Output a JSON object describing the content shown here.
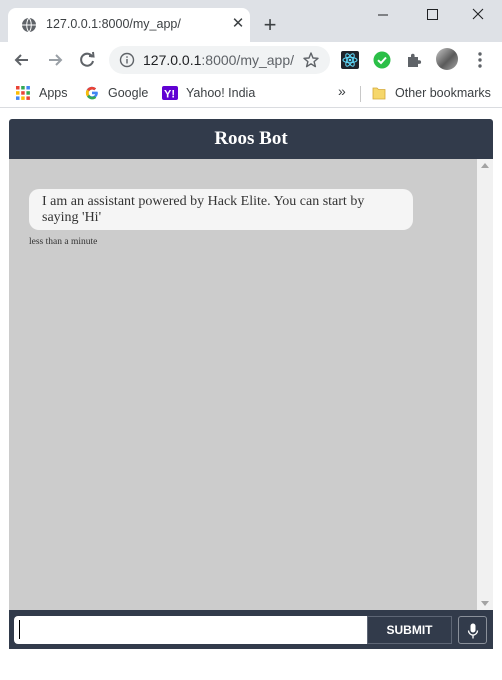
{
  "browser": {
    "tab": {
      "title": "127.0.0.1:8000/my_app/",
      "close_glyph": "✕"
    },
    "new_tab_glyph": "+",
    "address": {
      "host": "127.0.0.1",
      "path": ":8000/my_app/"
    },
    "bookmarks": [
      {
        "label": "Apps",
        "icon": "apps-grid-icon"
      },
      {
        "label": "Google",
        "icon": "google-icon"
      },
      {
        "label": "Yahoo! India",
        "icon": "yahoo-icon"
      }
    ],
    "bookmarks_overflow": "»",
    "other_bookmarks": "Other bookmarks"
  },
  "chat": {
    "title": "Roos Bot",
    "messages": [
      {
        "text": "I am an assistant powered by Hack Elite. You can start by saying 'Hi'",
        "time": "less than a minute"
      }
    ],
    "input": {
      "value": ""
    },
    "submit_label": "SUBMIT"
  },
  "colors": {
    "header": "#323b4b",
    "body": "#cccccc",
    "bubble": "#f5f5f5"
  }
}
